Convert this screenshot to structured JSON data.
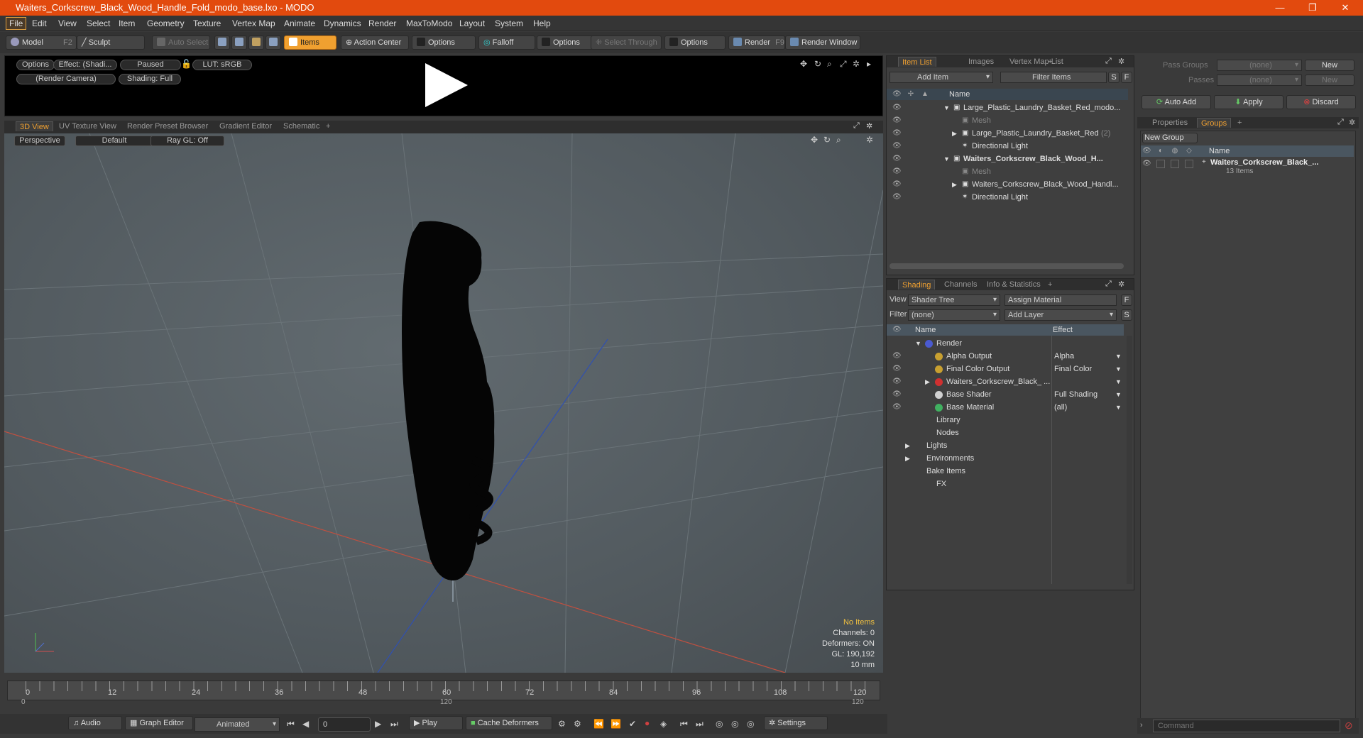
{
  "window": {
    "title": "Waiters_Corkscrew_Black_Wood_Handle_Fold_modo_base.lxo - MODO",
    "minimize": "—",
    "restore": "❐",
    "close": "✕"
  },
  "menu": [
    "File",
    "Edit",
    "View",
    "Select",
    "Item",
    "Geometry",
    "Texture",
    "Vertex Map",
    "Animate",
    "Dynamics",
    "Render",
    "MaxToModo",
    "Layout",
    "System",
    "Help"
  ],
  "toolbar": {
    "model": "Model",
    "model_key": "F2",
    "sculpt": "Sculpt",
    "auto_select": "Auto Select",
    "items": "Items",
    "action_center": "Action Center",
    "options1": "Options",
    "falloff": "Falloff",
    "options2": "Options",
    "select_through": "Select Through",
    "options3": "Options",
    "render": "Render",
    "render_key": "F9",
    "render_window": "Render Window"
  },
  "preview": {
    "options": "Options",
    "effect": "Effect: (Shadi...",
    "paused": "Paused",
    "lut": "LUT: sRGB",
    "camera": "(Render Camera)",
    "shading": "Shading: Full"
  },
  "viewport_tabs": [
    "3D View",
    "UV Texture View",
    "Render Preset Browser",
    "Gradient Editor",
    "Schematic",
    "+"
  ],
  "viewport": {
    "perspective": "Perspective",
    "default": "Default",
    "raygl": "Ray GL: Off",
    "stats": {
      "no_items": "No Items",
      "channels": "Channels: 0",
      "deformers": "Deformers: ON",
      "gl": "GL: 190,192",
      "scale": "10 mm"
    }
  },
  "timeline": {
    "ticks": [
      "0",
      "12",
      "24",
      "36",
      "48",
      "60",
      "72",
      "84",
      "96",
      "108",
      "120"
    ],
    "sub": [
      "0",
      "120",
      "120"
    ]
  },
  "bottom": {
    "audio": "Audio",
    "graph_editor": "Graph Editor",
    "animated": "Animated",
    "frame": "0",
    "play": "Play",
    "cache": "Cache Deformers",
    "settings": "Settings"
  },
  "item_list": {
    "tabs": [
      "Item List",
      "Images",
      "Vertex Map List",
      "+"
    ],
    "add_item": "Add Item",
    "filter": "Filter Items",
    "s": "S",
    "f": "F",
    "col_name": "Name",
    "rows": [
      {
        "label": "Large_Plastic_Laundry_Basket_Red_modo...",
        "indent": 0,
        "arrow": "▼",
        "dim": false,
        "bold": false
      },
      {
        "label": "Mesh",
        "indent": 1,
        "arrow": "",
        "dim": true,
        "bold": false
      },
      {
        "label": "Large_Plastic_Laundry_Basket_Red",
        "suffix": "(2)",
        "indent": 1,
        "arrow": "▶",
        "dim": false,
        "bold": false
      },
      {
        "label": "Directional Light",
        "indent": 1,
        "arrow": "",
        "dim": false,
        "bold": false
      },
      {
        "label": "Waiters_Corkscrew_Black_Wood_H...",
        "indent": 0,
        "arrow": "▼",
        "dim": false,
        "bold": true
      },
      {
        "label": "Mesh",
        "indent": 1,
        "arrow": "",
        "dim": true,
        "bold": false
      },
      {
        "label": "Waiters_Corkscrew_Black_Wood_Handl...",
        "indent": 1,
        "arrow": "▶",
        "dim": false,
        "bold": false
      },
      {
        "label": "Directional Light",
        "indent": 1,
        "arrow": "",
        "dim": false,
        "bold": false
      }
    ]
  },
  "shading": {
    "tabs": [
      "Shading",
      "Channels",
      "Info & Statistics",
      "+"
    ],
    "view_label": "View",
    "view_value": "Shader Tree",
    "assign": "Assign Material",
    "filter_label": "Filter",
    "filter_value": "(none)",
    "add_layer": "Add Layer",
    "f": "F",
    "s": "S",
    "col_name": "Name",
    "col_effect": "Effect",
    "rows": [
      {
        "label": "Render",
        "effect": "",
        "indent": 0,
        "arrow": "▼",
        "eye": false,
        "dot": "#4a5ad0"
      },
      {
        "label": "Alpha Output",
        "effect": "Alpha",
        "indent": 1,
        "arrow": "",
        "eye": true,
        "dot": "#c8a030"
      },
      {
        "label": "Final Color Output",
        "effect": "Final Color",
        "indent": 1,
        "arrow": "",
        "eye": true,
        "dot": "#c8a030"
      },
      {
        "label": "Waiters_Corkscrew_Black_ ...",
        "effect": "",
        "indent": 1,
        "arrow": "▶",
        "eye": true,
        "dot": "#d03030"
      },
      {
        "label": "Base Shader",
        "effect": "Full Shading",
        "indent": 1,
        "arrow": "",
        "eye": true,
        "dot": "#d0d0d0"
      },
      {
        "label": "Base Material",
        "effect": "(all)",
        "indent": 1,
        "arrow": "",
        "eye": true,
        "dot": "#40b060"
      },
      {
        "label": "Library",
        "effect": "",
        "indent": 0,
        "arrow": "",
        "eye": false,
        "dot": ""
      },
      {
        "label": "Nodes",
        "effect": "",
        "indent": 0,
        "arrow": "",
        "eye": false,
        "dot": ""
      },
      {
        "label": "Lights",
        "effect": "",
        "indent": -1,
        "arrow": "▶",
        "eye": false,
        "dot": ""
      },
      {
        "label": "Environments",
        "effect": "",
        "indent": -1,
        "arrow": "▶",
        "eye": false,
        "dot": ""
      },
      {
        "label": "Bake Items",
        "effect": "",
        "indent": -1,
        "arrow": "",
        "eye": false,
        "dot": ""
      },
      {
        "label": "FX",
        "effect": "",
        "indent": 0,
        "arrow": "",
        "eye": false,
        "dot": ""
      }
    ]
  },
  "groups": {
    "pass_groups": "Pass Groups",
    "pass_groups_val": "(none)",
    "new": "New",
    "passes": "Passes",
    "passes_val": "(none)",
    "new2": "New",
    "auto_add": "Auto Add",
    "apply": "Apply",
    "discard": "Discard",
    "tabs": [
      "Properties",
      "Groups",
      "+"
    ],
    "new_group": "New Group",
    "col_name": "Name",
    "item": "Waiters_Corkscrew_Black_...",
    "item_count": "13 Items"
  },
  "command": {
    "placeholder": "Command"
  }
}
